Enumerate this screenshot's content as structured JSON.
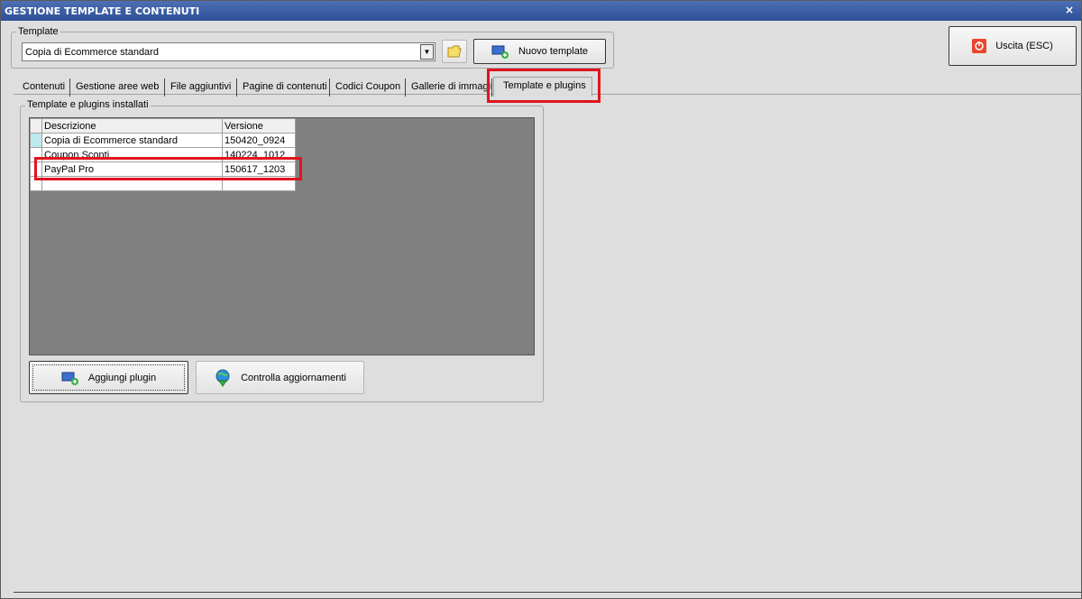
{
  "window": {
    "title": "GESTIONE TEMPLATE E CONTENUTI",
    "close_label": "×"
  },
  "template_group": {
    "legend": "Template",
    "selected_value": "Copia di Ecommerce standard",
    "new_button_label": "Nuovo template"
  },
  "exit_button_label": "Uscita (ESC)",
  "tabs": [
    {
      "label": "Contenuti"
    },
    {
      "label": "Gestione aree web"
    },
    {
      "label": "File aggiuntivi"
    },
    {
      "label": "Pagine di contenuti"
    },
    {
      "label": "Codici Coupon"
    },
    {
      "label": "Gallerie di immagini"
    },
    {
      "label": "Template e plugins"
    }
  ],
  "active_tab": "Template e plugins",
  "plugins_group": {
    "legend": "Template e plugins installati",
    "columns": [
      "Descrizione",
      "Versione"
    ],
    "rows": [
      {
        "descrizione": "Copia di Ecommerce standard",
        "versione": "150420_0924"
      },
      {
        "descrizione": "Coupon Sconti",
        "versione": "140224_1012"
      },
      {
        "descrizione": "PayPal Pro",
        "versione": "150617_1203"
      }
    ],
    "add_button_label": "Aggiungi plugin",
    "check_updates_label": "Controlla aggiornamenti"
  },
  "colors": {
    "titlebar": "#2c4f96",
    "highlight": "#e0141e",
    "grid_bg": "#808080"
  }
}
